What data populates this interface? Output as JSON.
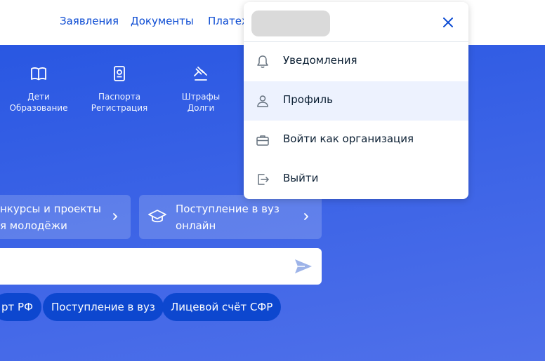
{
  "nav": {
    "items": [
      "Заявления",
      "Документы",
      "Платежи"
    ]
  },
  "categories": [
    {
      "icon": "book-icon",
      "line1": "Дети",
      "line2": "Образование"
    },
    {
      "icon": "passport-icon",
      "line1": "Паспорта",
      "line2": "Регистрация"
    },
    {
      "icon": "gavel-icon",
      "line1": "Штрафы",
      "line2": "Долги"
    }
  ],
  "cards": [
    {
      "line1": "нкурсы и проекты",
      "line2": "я молодёжи"
    },
    {
      "line1": "Поступление в вуз",
      "line2": "онлайн",
      "icon": "graduation-cap-icon"
    }
  ],
  "search": {
    "value": ""
  },
  "chips": [
    "рт РФ",
    "Поступление в вуз",
    "Лицевой счёт СФР"
  ],
  "menu": {
    "items": [
      {
        "label": "Уведомления",
        "icon": "bell-icon"
      },
      {
        "label": "Профиль",
        "icon": "user-icon",
        "active": true
      },
      {
        "label": "Войти как организация",
        "icon": "briefcase-icon"
      },
      {
        "label": "Выйти",
        "icon": "logout-icon"
      }
    ]
  },
  "colors": {
    "primary": "#0d4cd3",
    "hero": "#3b63e6",
    "chip": "#0d47cf",
    "active_item": "#edf2fe"
  }
}
